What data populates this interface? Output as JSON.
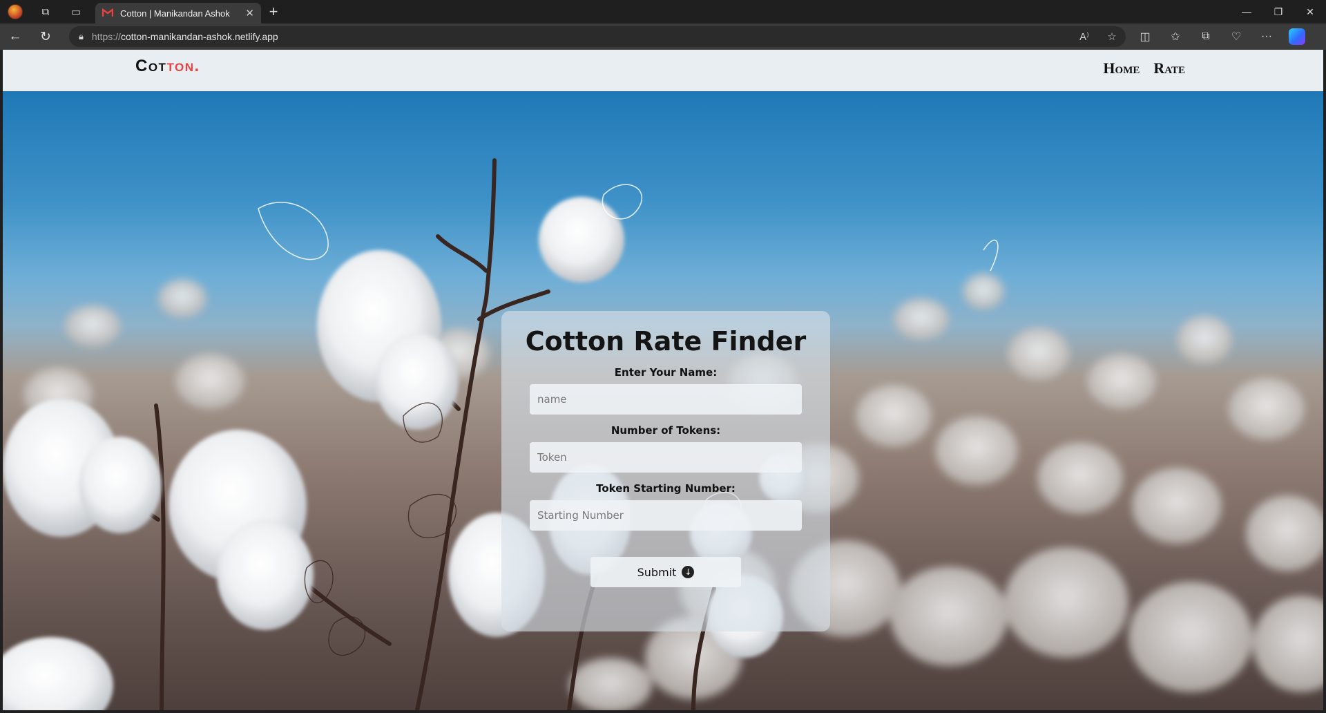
{
  "browser": {
    "tab_title": "Cotton | Manikandan Ashok",
    "url_protocol": "https://",
    "url_host": "cotton-manikandan-ashok.netlify.app"
  },
  "site": {
    "logo_main": "Cot",
    "logo_accent": "ton.",
    "nav": [
      "Home",
      "Rate"
    ]
  },
  "form": {
    "title": "Cotton Rate Finder",
    "name_label": "Enter Your Name:",
    "name_placeholder": "name",
    "tokens_label": "Number of Tokens:",
    "tokens_placeholder": "Token",
    "start_label": "Token Starting Number:",
    "start_placeholder": "Starting Number",
    "submit_label": "Submit"
  },
  "colors": {
    "accent": "#e9413f",
    "nav_bg": "#e8eef2",
    "sky": "#1f78b6"
  }
}
